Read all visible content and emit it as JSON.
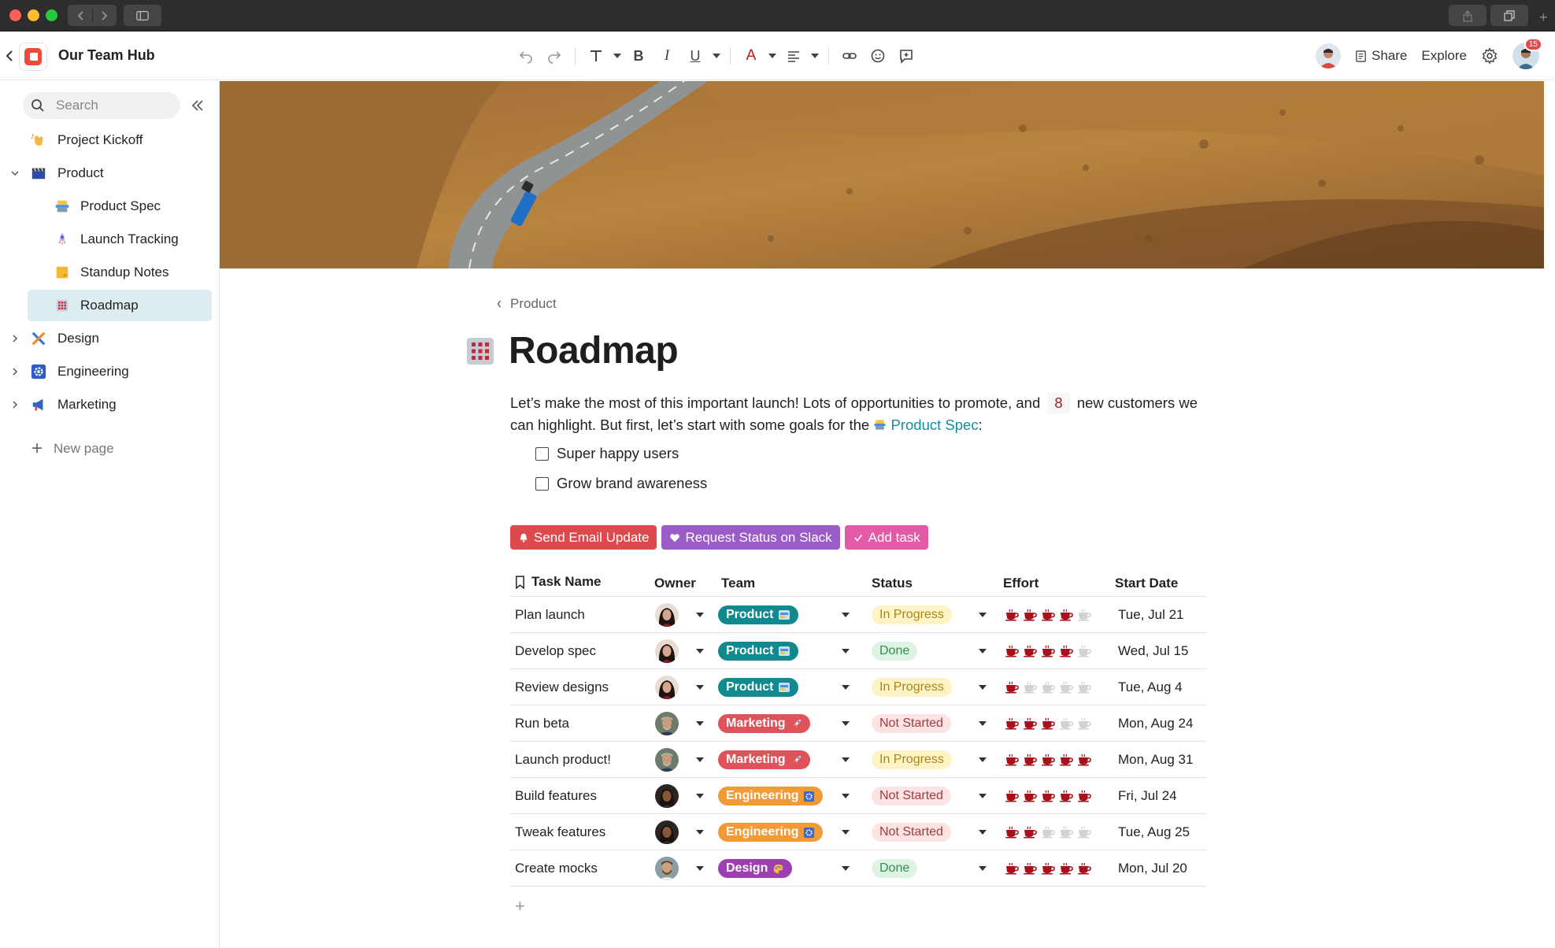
{
  "app": {
    "doc_title": "Our Team Hub",
    "share_label": "Share",
    "explore_label": "Explore",
    "notification_count": "15"
  },
  "sidebar": {
    "search_placeholder": "Search",
    "items": [
      {
        "label": "Project Kickoff",
        "icon": "wave-hand-icon"
      },
      {
        "label": "Product",
        "icon": "clapperboard-icon"
      },
      {
        "label": "Product Spec",
        "icon": "spec-icon"
      },
      {
        "label": "Launch Tracking",
        "icon": "rocket-icon"
      },
      {
        "label": "Standup Notes",
        "icon": "note-icon"
      },
      {
        "label": "Roadmap",
        "icon": "grid-icon"
      },
      {
        "label": "Design",
        "icon": "tools-icon"
      },
      {
        "label": "Engineering",
        "icon": "gear-icon"
      },
      {
        "label": "Marketing",
        "icon": "megaphone-icon"
      }
    ],
    "new_page_label": "New page"
  },
  "page": {
    "breadcrumb": "Product",
    "title": "Roadmap",
    "intro_before": "Let’s make the most of this important launch! Lots of opportunities to promote, and",
    "intro_number": "8",
    "intro_after": "new customers we can highlight. But first, let’s start with some goals for the",
    "intro_link": "Product Spec",
    "intro_end": ":",
    "goals": [
      "Super happy users",
      "Grow brand awareness"
    ]
  },
  "actions": [
    {
      "label": "Send Email Update",
      "color": "#dc4a4e"
    },
    {
      "label": "Request Status on Slack",
      "color": "#9a5cc6"
    },
    {
      "label": "Add task",
      "color": "#e15ba6"
    }
  ],
  "table": {
    "headers": [
      "Task Name",
      "Owner",
      "Team",
      "Status",
      "Effort",
      "Start Date"
    ],
    "rows": [
      {
        "task": "Plan launch",
        "owner": "woman-dark-hair",
        "team": "Product",
        "status": "In Progress",
        "effort": 4,
        "date": "Tue, Jul 21"
      },
      {
        "task": "Develop spec",
        "owner": "woman-dark-hair",
        "team": "Product",
        "status": "Done",
        "effort": 4,
        "date": "Wed, Jul 15"
      },
      {
        "task": "Review designs",
        "owner": "woman-dark-hair",
        "team": "Product",
        "status": "In Progress",
        "effort": 1,
        "date": "Tue, Aug 4"
      },
      {
        "task": "Run beta",
        "owner": "man-gray-hair",
        "team": "Marketing",
        "status": "Not Started",
        "effort": 3,
        "date": "Mon, Aug 24"
      },
      {
        "task": "Launch product!",
        "owner": "man-gray-hair",
        "team": "Marketing",
        "status": "In Progress",
        "effort": 5,
        "date": "Mon, Aug 31"
      },
      {
        "task": "Build features",
        "owner": "woman-dark-skin",
        "team": "Engineering",
        "status": "Not Started",
        "effort": 5,
        "date": "Fri, Jul 24"
      },
      {
        "task": "Tweak features",
        "owner": "woman-dark-skin",
        "team": "Engineering",
        "status": "Not Started",
        "effort": 2,
        "date": "Tue, Aug 25"
      },
      {
        "task": "Create mocks",
        "owner": "man-beard",
        "team": "Design",
        "status": "Done",
        "effort": 5,
        "date": "Mon, Jul 20"
      }
    ],
    "effort_max": 5
  },
  "colors": {
    "team_product": "#10898f",
    "team_marketing": "#e0525a",
    "team_engineering": "#f19a38",
    "team_design": "#9d3fb0",
    "status_in_progress_bg": "#fdf3c4",
    "status_in_progress_fg": "#a8871b",
    "status_done_bg": "#dff3e4",
    "status_done_fg": "#2f8f4e",
    "status_not_started_bg": "#fde3e4",
    "status_not_started_fg": "#9a3d3d",
    "cup_filled": "#a8101c",
    "cup_empty": "#d2d2d2"
  }
}
